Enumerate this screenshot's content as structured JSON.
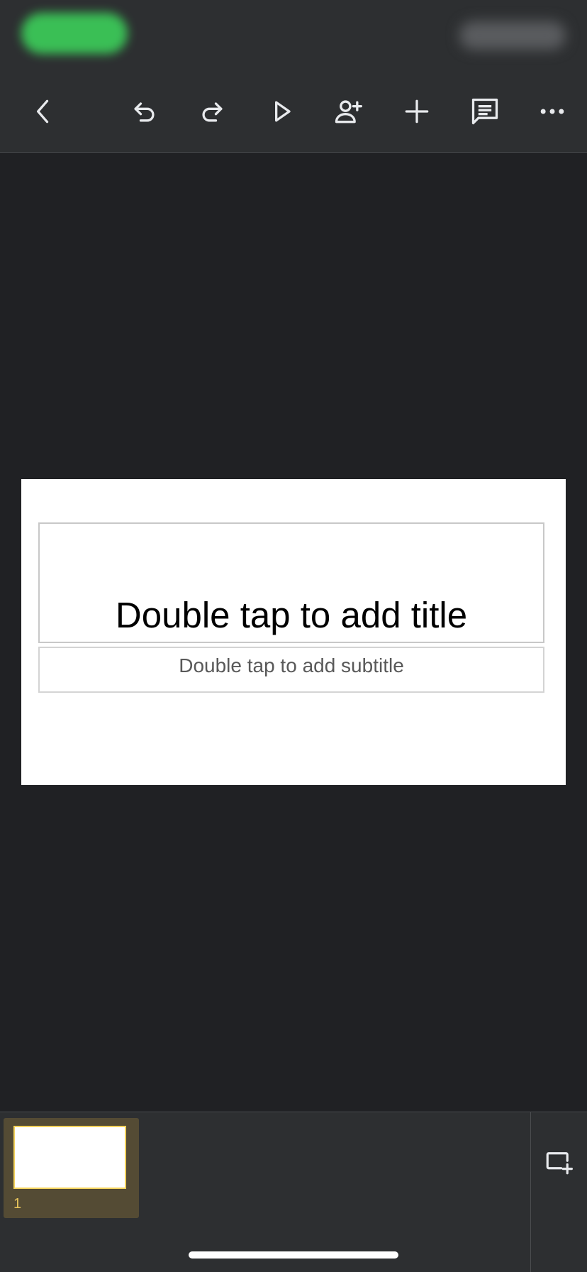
{
  "toolbar": {
    "icons": [
      "back-icon",
      "undo-icon",
      "redo-icon",
      "present-icon",
      "share-icon",
      "add-icon",
      "comment-icon",
      "more-icon"
    ]
  },
  "slide": {
    "title_placeholder": "Double tap to add title",
    "subtitle_placeholder": "Double tap to add subtitle"
  },
  "filmstrip": {
    "slides": [
      {
        "number": "1"
      }
    ]
  },
  "colors": {
    "toolbar_bg": "#2d2f31",
    "canvas_bg": "#202124",
    "selected_thumb_bg": "#544b34",
    "selected_thumb_border": "#f4d35c"
  }
}
